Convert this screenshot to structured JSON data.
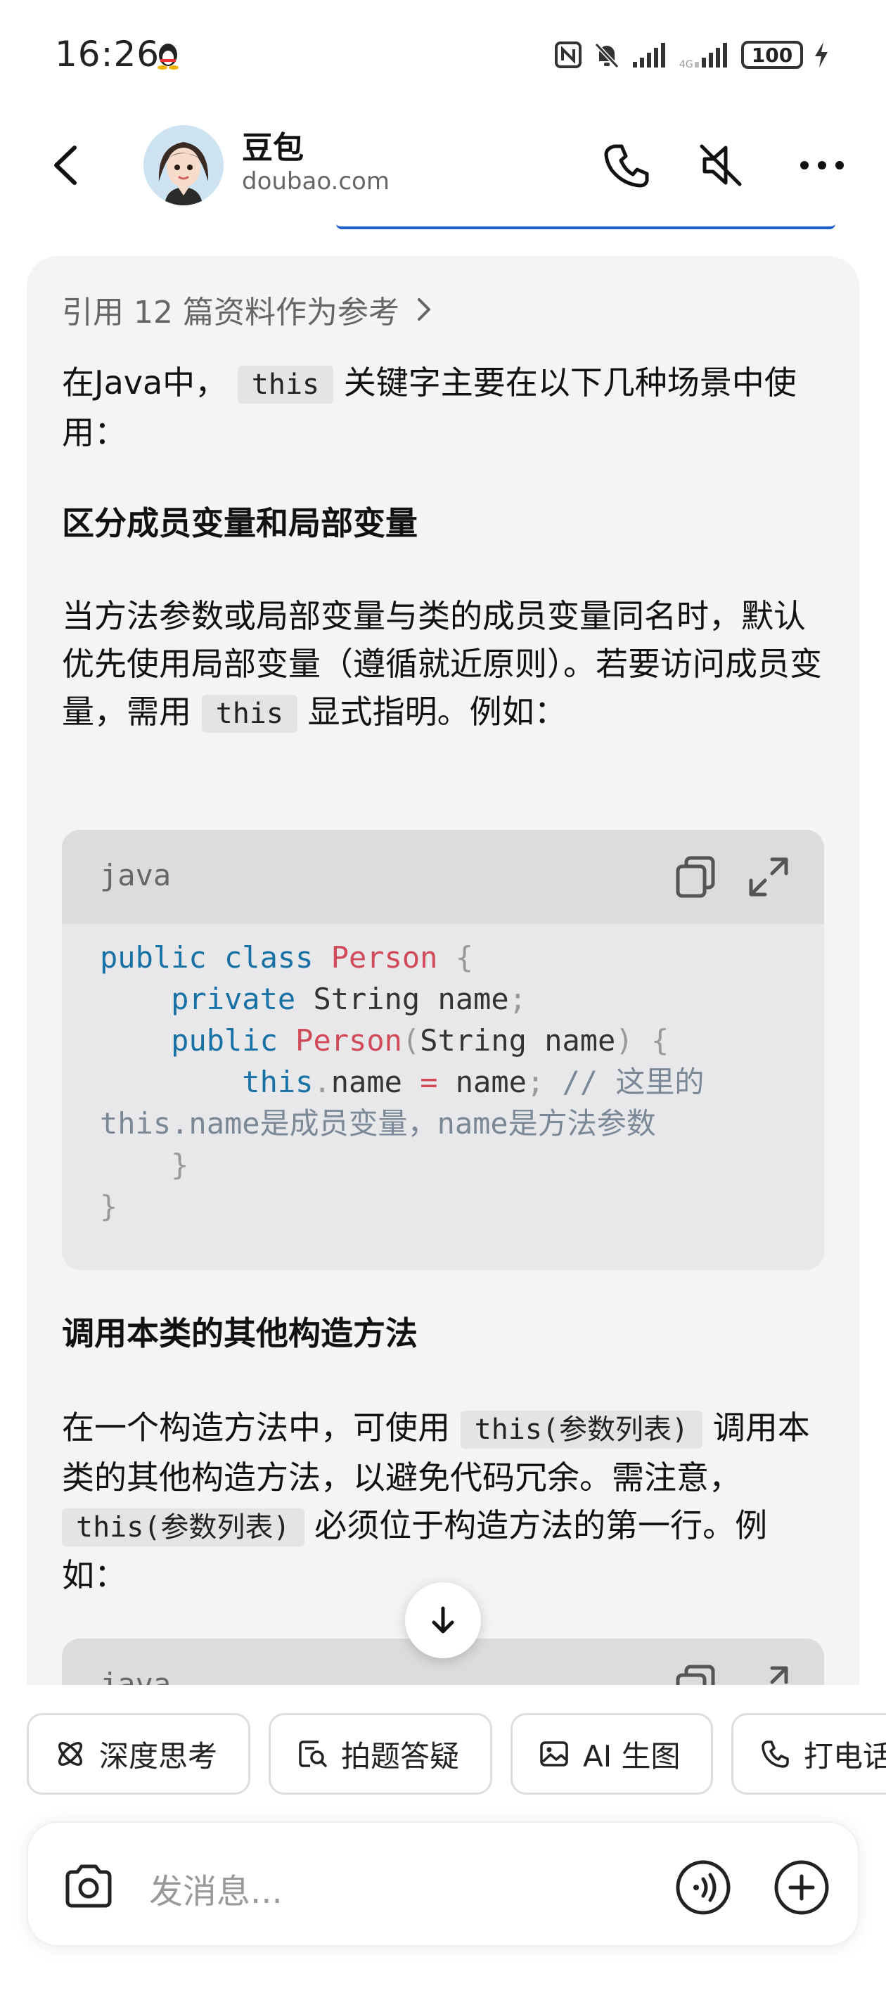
{
  "status_bar": {
    "time": "16:26",
    "battery": "100",
    "icons": [
      "qq-penguin-icon",
      "nfc-icon",
      "bell-muted-icon",
      "signal-icon",
      "signal-icon",
      "charging-icon"
    ]
  },
  "header": {
    "bot_name": "豆包",
    "bot_domain": "doubao.com"
  },
  "message": {
    "references": "引用 12 篇资料作为参考",
    "intro_pre": "在Java中，",
    "intro_code": "this",
    "intro_post": "关键字主要在以下几种场景中使用：",
    "section1_title": "区分成员变量和局部变量",
    "section1_text_pre": "当方法参数或局部变量与类的成员变量同名时，默认优先使用局部变量（遵循就近原则）。若要访问成员变量，需用",
    "section1_code": "this",
    "section1_text_post": "显式指明。例如：",
    "code_block1": {
      "lang": "java",
      "lines": [
        "public class Person {",
        "    private String name;",
        "    public Person(String name) {",
        "        this.name = name; // 这里的",
        "this.name是成员变量，name是方法参数",
        "    }",
        "}"
      ]
    },
    "section2_title": "调用本类的其他构造方法",
    "section2_text_pre": "在一个构造方法中，可使用",
    "section2_code": "this(参数列表)",
    "section2_text_mid": "调用本类的其他构造方法，以避免代码冗余。需注意，",
    "section2_code2": "this(参数列表)",
    "section2_text_post": "必须位于构造方法的第一行。例如：",
    "code_block2": {
      "lang": "java"
    }
  },
  "chips": [
    {
      "label": "深度思考",
      "icon": "atom-icon"
    },
    {
      "label": "拍题答疑",
      "icon": "photo-search-icon"
    },
    {
      "label": "AI 生图",
      "icon": "image-icon"
    },
    {
      "label": "打电话",
      "icon": "phone-icon"
    }
  ],
  "input": {
    "placeholder": "发消息..."
  }
}
